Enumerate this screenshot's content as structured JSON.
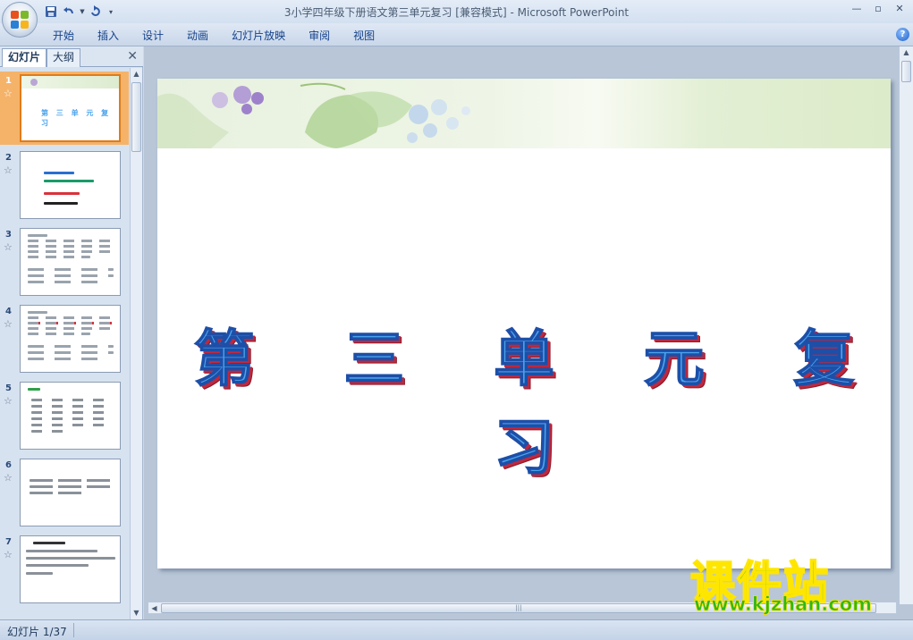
{
  "window": {
    "title": "3小学四年级下册语文第三单元复习 [兼容模式] - Microsoft PowerPoint",
    "minimize": "—",
    "restore": "▫",
    "close": "✕"
  },
  "quick_access": [
    "save-icon",
    "undo-icon",
    "undo-dropdown-icon",
    "redo-icon",
    "customize-dropdown-icon"
  ],
  "ribbon": {
    "tabs": [
      "开始",
      "插入",
      "设计",
      "动画",
      "幻灯片放映",
      "审阅",
      "视图"
    ],
    "help": "?"
  },
  "left_pane": {
    "tab_slides": "幻灯片",
    "tab_outline": "大纲",
    "close": "✕",
    "thumbnails": [
      {
        "num": "1",
        "selected": true,
        "title": "第 三 单 元 复 习"
      },
      {
        "num": "2",
        "selected": false
      },
      {
        "num": "3",
        "selected": false
      },
      {
        "num": "4",
        "selected": false
      },
      {
        "num": "5",
        "selected": false
      },
      {
        "num": "6",
        "selected": false
      },
      {
        "num": "7",
        "selected": false
      }
    ],
    "star": "☆"
  },
  "slide": {
    "title": "第 三 单 元 复 习"
  },
  "watermark": {
    "cn": "课件站",
    "url": "www.kjzhan.com"
  },
  "status": {
    "slide_counter": "幻灯片 1/37"
  },
  "colors": {
    "title_fill": "#4aa3ec",
    "title_outline": "#1d4fa8",
    "title_shadow": "#c0283d",
    "selected_thumb": "#f5b36a",
    "watermark_green": "#2fb61e",
    "watermark_yellow": "#ffe600"
  }
}
